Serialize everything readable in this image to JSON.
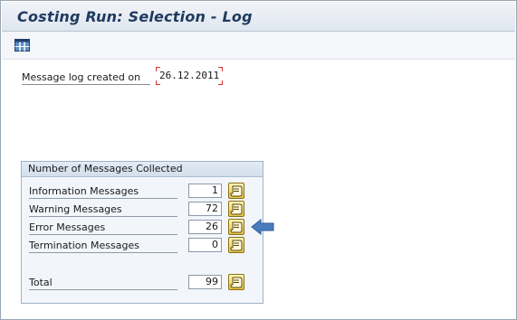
{
  "window": {
    "title": "Costing Run: Selection - Log"
  },
  "toolbar": {
    "buttons": [
      {
        "icon": "layout-grid-icon"
      }
    ]
  },
  "log": {
    "label": "Message log created on",
    "date": "26.12.2011"
  },
  "messages": {
    "group_title": "Number of Messages Collected",
    "rows": [
      {
        "label": "Information Messages",
        "count": "1",
        "icon": "scroll-icon"
      },
      {
        "label": "Warning Messages",
        "count": "72",
        "icon": "scroll-icon"
      },
      {
        "label": "Error Messages",
        "count": "26",
        "icon": "scroll-icon"
      },
      {
        "label": "Termination Messages",
        "count": "0",
        "icon": "scroll-icon"
      }
    ],
    "total": {
      "label": "Total",
      "count": "99",
      "icon": "scroll-icon"
    }
  },
  "annotation": {
    "icon": "left-arrow-icon",
    "color": "#4a7bbd"
  },
  "colors": {
    "title": "#1f3a5f",
    "accent": "#e7c84a",
    "group_bg": "#f2f6fb"
  }
}
